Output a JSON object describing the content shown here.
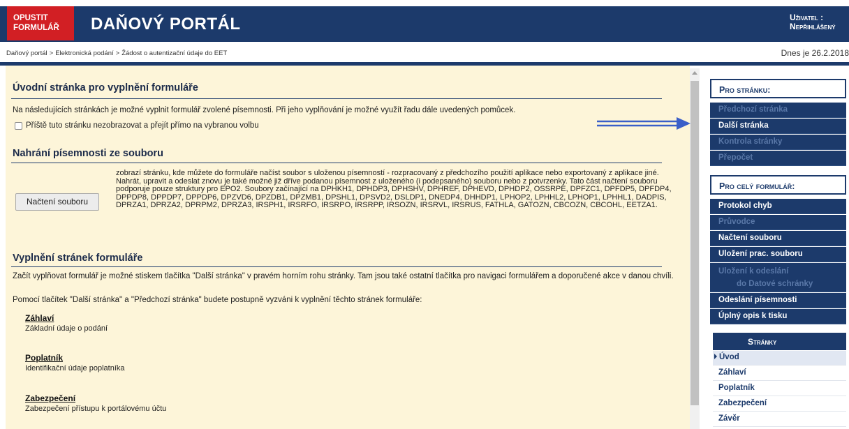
{
  "header": {
    "exit_line1": "OPUSTIT",
    "exit_line2": "FORMULÁŘ",
    "title": "DAŇOVÝ PORTÁL",
    "user_line1": "Uživatel :",
    "user_line2": "Nepřihlášený"
  },
  "breadcrumb": [
    "Daňový portál",
    "Elektronická podání",
    "Žádost o autentizační údaje do EET"
  ],
  "date": "Dnes je 26.2.2018",
  "main": {
    "intro_title": "Úvodní stránka pro vyplnění formuláře",
    "intro_text": "Na následujících stránkách je možné vyplnit formulář zvolené písemnosti. Při jeho vyplňování je možné využít řadu dále uvedených pomůcek.",
    "checkbox_label": "Příště tuto stránku nezobrazovat a přejít přímo na vybranou volbu",
    "upload_title": "Nahrání písemnosti ze souboru",
    "load_button": "Načtení souboru",
    "load_description": "zobrazí stránku, kde můžete do formuláře načíst soubor s uloženou písemností - rozpracovaný z předchozího použití aplikace nebo exportovaný z aplikace jiné. Nahrát, upravit a odeslat znovu je také možné již dříve podanou písemnost z uloženého (i podepsaného) souboru nebo z potvrzenky. Tato část načtení souboru podporuje pouze struktury pro EPO2. Soubory začínající na DPHKH1, DPHDP3, DPHSHV, DPHREF, DPHEVD, DPHDP2, OSSRPE, DPFZC1, DPFDP5, DPFDP4, DPPDP8, DPPDP7, DPPDP6, DPZVD6, DPZDB1, DPZMB1, DPSHL1, DPSVD2, DSLDP1, DNEDP4, DHHDP1, LPHOP2, LPHHL2, LPHOP1, LPHHL1, DADPIS, DPRZA1, DPRZA2, DPRPM2, DPRZA3, IRSPH1, IRSRFO, IRSRPO, IRSRPP, IRSOZN, IRSRVL, IRSRUS, FATHLA, GATOZN, CBCOZN, CBCOHL, EETZA1.",
    "fill_title": "Vyplnění stránek formuláře",
    "fill_text1": "Začít vyplňovat formulář je možné stiskem tlačítka \"Další stránka\" v pravém horním rohu stránky. Tam jsou také ostatní tlačítka pro navigaci formulářem a doporučené akce v danou chvíli.",
    "fill_text2": "Pomocí tlačítek \"Další stránka\" a \"Předchozí stránka\" budete postupně vyzváni k vyplnění těchto stránek formuláře:",
    "pages": [
      {
        "title": "Záhlaví",
        "desc": "Základní údaje o podání"
      },
      {
        "title": "Poplatník",
        "desc": "Identifikační údaje poplatníka"
      },
      {
        "title": "Zabezpečení",
        "desc": "Zabezpečení přístupu k portálovému účtu"
      }
    ]
  },
  "sidebar": {
    "page_head": "Pro stránku:",
    "page_items": [
      "Předchozí stránka",
      "Další stránka",
      "Kontrola stránky",
      "Přepočet"
    ],
    "form_head": "Pro celý formulář:",
    "form_items": [
      "Protokol chyb",
      "Průvodce",
      "Načtení souboru",
      "Uložení prac. souboru",
      "Uložení k odeslání",
      "do Datové schránky",
      "Odeslání písemnosti",
      "Úplný opis k tisku"
    ],
    "pages_head": "Stránky",
    "pages_items": [
      "Úvod",
      "Záhlaví",
      "Poplatník",
      "Zabezpečení",
      "Závěr"
    ]
  },
  "colors": {
    "navy": "#1c3a6b",
    "exit_red": "#d21f24",
    "content_bg": "#fdf5d9",
    "arrow": "#3a5ec8"
  }
}
